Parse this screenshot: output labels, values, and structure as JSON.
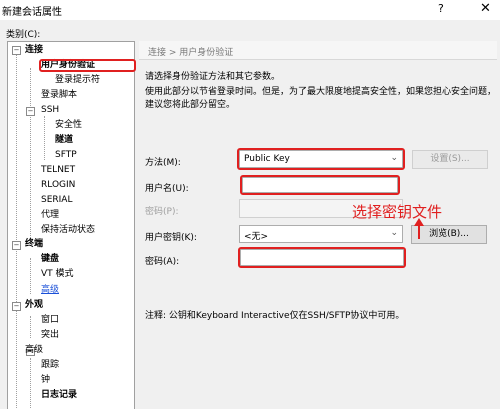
{
  "window": {
    "title": "新建会话属性",
    "help_label": "?",
    "close_label": "✕"
  },
  "category_label": "类别(C):",
  "tree": [
    {
      "label": "连接",
      "bold": true
    },
    {
      "label": "用户身份验证",
      "bold": true
    },
    {
      "label": "登录提示符"
    },
    {
      "label": "登录脚本"
    },
    {
      "label": "SSH"
    },
    {
      "label": "安全性"
    },
    {
      "label": "隧道",
      "bold": true
    },
    {
      "label": "SFTP"
    },
    {
      "label": "TELNET"
    },
    {
      "label": "RLOGIN"
    },
    {
      "label": "SERIAL"
    },
    {
      "label": "代理"
    },
    {
      "label": "保持活动状态"
    },
    {
      "label": "终端",
      "bold": true
    },
    {
      "label": "键盘",
      "bold": true
    },
    {
      "label": "VT 模式"
    },
    {
      "label": "高级",
      "link": true
    },
    {
      "label": "外观",
      "bold": true
    },
    {
      "label": "窗口"
    },
    {
      "label": "突出"
    },
    {
      "label": "高级"
    },
    {
      "label": "跟踪"
    },
    {
      "label": "钟"
    },
    {
      "label": "日志记录",
      "bold": true
    }
  ],
  "breadcrumb": "连接 > 用户身份验证",
  "intro": {
    "line1": "请选择身份验证方法和其它参数。",
    "line2": "使用此部分以节省登录时间。但是，为了最大限度地提高安全性，如果您担心安全问题，",
    "line3": "建议您将此部分留空。"
  },
  "form": {
    "method_label": "方法(M):",
    "method_value": "Public Key",
    "settings_button": "设置(S)...",
    "username_label": "用户名(U):",
    "username_value": "",
    "password_label": "密码(P):",
    "user_key_label": "用户密钥(K):",
    "user_key_value": "<无>",
    "browse_button": "浏览(B)...",
    "passphrase_label": "密码(A):",
    "passphrase_value": ""
  },
  "annotation": "选择密钥文件",
  "note": "注释: 公钥和Keyboard Interactive仅在SSH/SFTP协议中可用。",
  "colors": {
    "highlight_red": "#e02020",
    "link_blue": "#1a4fd8"
  }
}
